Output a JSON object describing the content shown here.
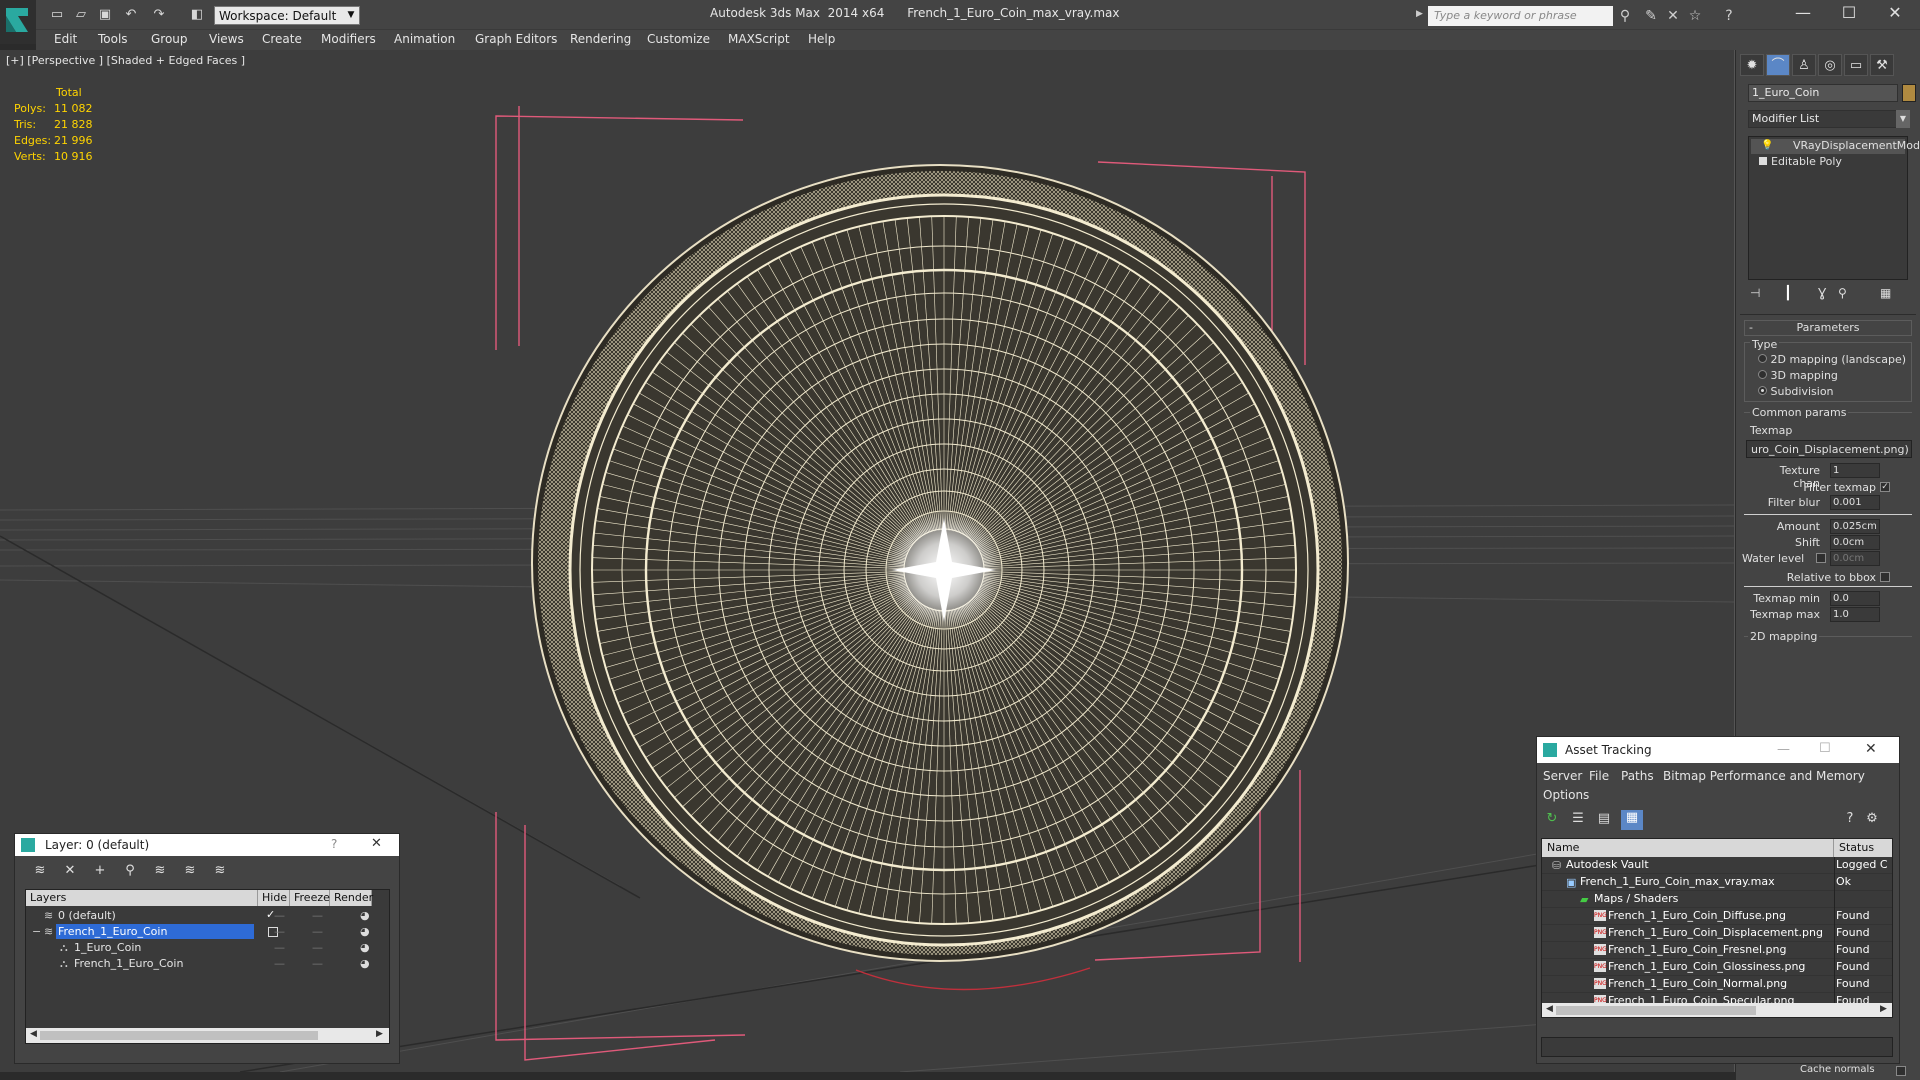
{
  "app": {
    "title": "Autodesk 3ds Max  2014 x64      French_1_Euro_Coin_max_vray.max",
    "workspace": "Workspace: Default",
    "search_placeholder": "Type a keyword or phrase"
  },
  "menu": [
    "Edit",
    "Tools",
    "Group",
    "Views",
    "Create",
    "Modifiers",
    "Animation",
    "Graph Editors",
    "Rendering",
    "Customize",
    "MAXScript",
    "Help"
  ],
  "viewport": {
    "label": "[+] [Perspective ] [Shaded + Edged Faces ]",
    "stats": {
      "header": "Total",
      "polys_label": "Polys:",
      "polys": "11 082",
      "tris_label": "Tris:",
      "tris": "21 828",
      "edges_label": "Edges:",
      "edges": "21 996",
      "verts_label": "Verts:",
      "verts": "10 916"
    }
  },
  "command_panel": {
    "object_name": "1_Euro_Coin",
    "modifier_list": "Modifier List",
    "stack": [
      "VRayDisplacementMod",
      "Editable Poly"
    ],
    "rollout_parameters": "Parameters",
    "type_label": "Type",
    "type_options": [
      "2D mapping (landscape)",
      "3D mapping",
      "Subdivision"
    ],
    "common_params": "Common params",
    "texmap_label": "Texmap",
    "texmap_value": "uro_Coin_Displacement.png)",
    "texture_chan_label": "Texture chan",
    "texture_chan_value": "1",
    "filter_texmap_label": "Filter texmap",
    "filter_blur_label": "Filter blur",
    "filter_blur_value": "0.001",
    "amount_label": "Amount",
    "amount_value": "0.025cm",
    "shift_label": "Shift",
    "shift_value": "0.0cm",
    "water_level_label": "Water level",
    "water_level_value": "0.0cm",
    "relative_bbox_label": "Relative to bbox",
    "texmap_min_label": "Texmap min",
    "texmap_min_value": "0.0",
    "texmap_max_label": "Texmap max",
    "texmap_max_value": "1.0",
    "mapping_2d": "2D mapping",
    "cache_normals": "Cache normals"
  },
  "layer_dialog": {
    "title": "Layer: 0 (default)",
    "help": "?",
    "close": "✕",
    "columns": [
      "Layers",
      "Hide",
      "Freeze",
      "Render"
    ],
    "rows": [
      {
        "name": "0 (default)",
        "indent": 0,
        "selected": false
      },
      {
        "name": "French_1_Euro_Coin",
        "indent": 0,
        "selected": true
      },
      {
        "name": "1_Euro_Coin",
        "indent": 1,
        "selected": false
      },
      {
        "name": "French_1_Euro_Coin",
        "indent": 1,
        "selected": false
      }
    ]
  },
  "asset_dialog": {
    "title": "Asset Tracking",
    "menu": [
      "Server",
      "File",
      "Paths",
      "Bitmap Performance and Memory",
      "Options"
    ],
    "columns": [
      "Name",
      "Status"
    ],
    "rows": [
      {
        "name": "Autodesk Vault",
        "status": "Logged C",
        "indent": 1,
        "icon": "vault"
      },
      {
        "name": "French_1_Euro_Coin_max_vray.max",
        "status": "Ok",
        "indent": 2,
        "icon": "max"
      },
      {
        "name": "Maps / Shaders",
        "status": "",
        "indent": 3,
        "icon": "maps"
      },
      {
        "name": "French_1_Euro_Coin_Diffuse.png",
        "status": "Found",
        "indent": 4,
        "icon": "png"
      },
      {
        "name": "French_1_Euro_Coin_Displacement.png",
        "status": "Found",
        "indent": 4,
        "icon": "png"
      },
      {
        "name": "French_1_Euro_Coin_Fresnel.png",
        "status": "Found",
        "indent": 4,
        "icon": "png"
      },
      {
        "name": "French_1_Euro_Coin_Glossiness.png",
        "status": "Found",
        "indent": 4,
        "icon": "png"
      },
      {
        "name": "French_1_Euro_Coin_Normal.png",
        "status": "Found",
        "indent": 4,
        "icon": "png"
      },
      {
        "name": "French_1_Euro_Coin_Specular.png",
        "status": "Found",
        "indent": 4,
        "icon": "png"
      }
    ]
  },
  "colors": {
    "bg": "#2b2b2b",
    "viewport": "#3d3d3d",
    "stats": "#ffd400",
    "wire": "#f4ecd0",
    "bbox": "#e05a7a",
    "selection": "#2e6bd6"
  }
}
